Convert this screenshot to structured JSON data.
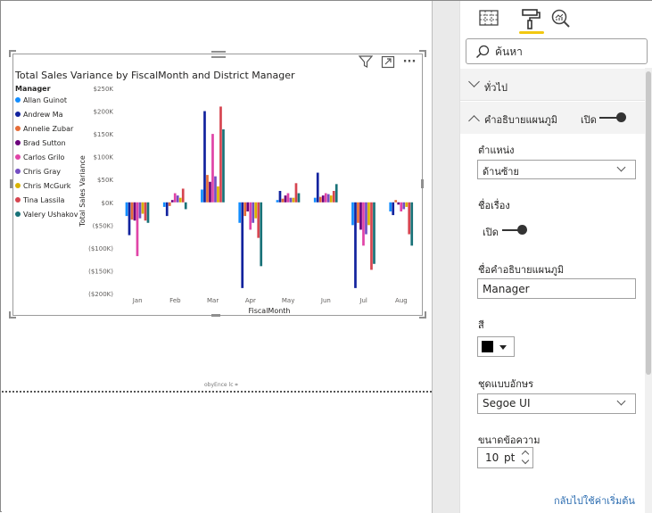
{
  "canvas": {
    "page_note": "obyEnce lc ⌗"
  },
  "visual": {
    "icons": [
      "filter-icon",
      "focus-mode-icon",
      "more-options-icon"
    ],
    "more_options_label": "···"
  },
  "chart_data": {
    "type": "bar",
    "title": "Total Sales Variance by FiscalMonth and District Manager",
    "xlabel": "FiscalMonth",
    "ylabel": "Total Sales Variance",
    "ylim": [
      -200000,
      250000
    ],
    "yticks": [
      250000,
      200000,
      150000,
      100000,
      50000,
      0,
      -50000,
      -100000,
      -150000,
      -200000
    ],
    "ytick_labels": [
      "$250K",
      "$200K",
      "$150K",
      "$100K",
      "$50K",
      "$0K",
      "($50K)",
      "($100K)",
      "($150K)",
      "($200K)"
    ],
    "categories": [
      "Jan",
      "Feb",
      "Mar",
      "Apr",
      "May",
      "Jun",
      "Jul",
      "Aug"
    ],
    "legend": {
      "title": "Manager",
      "position": "left"
    },
    "grid": false,
    "series": [
      {
        "name": "Allan Guinot",
        "color": "#118dff",
        "values": [
          -30000,
          -10000,
          28000,
          -45000,
          5000,
          10000,
          -50000,
          -20000
        ]
      },
      {
        "name": "Andrew Ma",
        "color": "#12239e",
        "values": [
          -72000,
          -30000,
          200000,
          -188000,
          25000,
          65000,
          -188000,
          -28000
        ]
      },
      {
        "name": "Annelie Zubar",
        "color": "#e66c37",
        "values": [
          -38000,
          -8000,
          60000,
          -30000,
          8000,
          12000,
          -45000,
          5000
        ]
      },
      {
        "name": "Brad Sutton",
        "color": "#6b007b",
        "values": [
          -40000,
          5000,
          45000,
          -20000,
          15000,
          15000,
          -60000,
          -5000
        ]
      },
      {
        "name": "Carlos Grilo",
        "color": "#e044a7",
        "values": [
          -118000,
          20000,
          150000,
          -60000,
          20000,
          20000,
          -95000,
          -20000
        ]
      },
      {
        "name": "Chris Gray",
        "color": "#744ec2",
        "values": [
          -35000,
          15000,
          57000,
          -45000,
          10000,
          18000,
          -70000,
          -15000
        ]
      },
      {
        "name": "Chris McGurk",
        "color": "#d9b300",
        "values": [
          -25000,
          10000,
          35000,
          -35000,
          10000,
          15000,
          -50000,
          -10000
        ]
      },
      {
        "name": "Tina Lassila",
        "color": "#d64550",
        "values": [
          -40000,
          30000,
          210000,
          -78000,
          42000,
          25000,
          -148000,
          -70000
        ]
      },
      {
        "name": "Valery Ushakov",
        "color": "#197278",
        "values": [
          -45000,
          -15000,
          160000,
          -140000,
          20000,
          40000,
          -135000,
          -95000
        ]
      }
    ]
  },
  "pane": {
    "tabs": [
      {
        "name": "fields-tab",
        "active": false
      },
      {
        "name": "format-tab",
        "active": true
      },
      {
        "name": "analytics-tab",
        "active": false
      }
    ],
    "search_placeholder": "ค้นหา",
    "general_section": "ทั่วไป",
    "legend_section": "คำอธิบายแผนภูมิ",
    "legend_toggle": "เปิด",
    "position_label": "ตำแหน่ง",
    "position_value": "ด้านซ้าย",
    "title_label": "ชื่อเรื่อง",
    "title_toggle": "เปิด",
    "legend_name_label": "ชื่อคำอธิบายแผนภูมิ",
    "legend_name_value": "Manager",
    "color_label": "สี",
    "color_value": "#000000",
    "font_family_label": "ชุดแบบอักษร",
    "font_family_value": "Segoe UI",
    "text_size_label": "ขนาดข้อความ",
    "text_size_value": "10",
    "text_size_unit": "pt",
    "revert_label": "กลับไปใช้ค่าเริ่มต้น"
  }
}
